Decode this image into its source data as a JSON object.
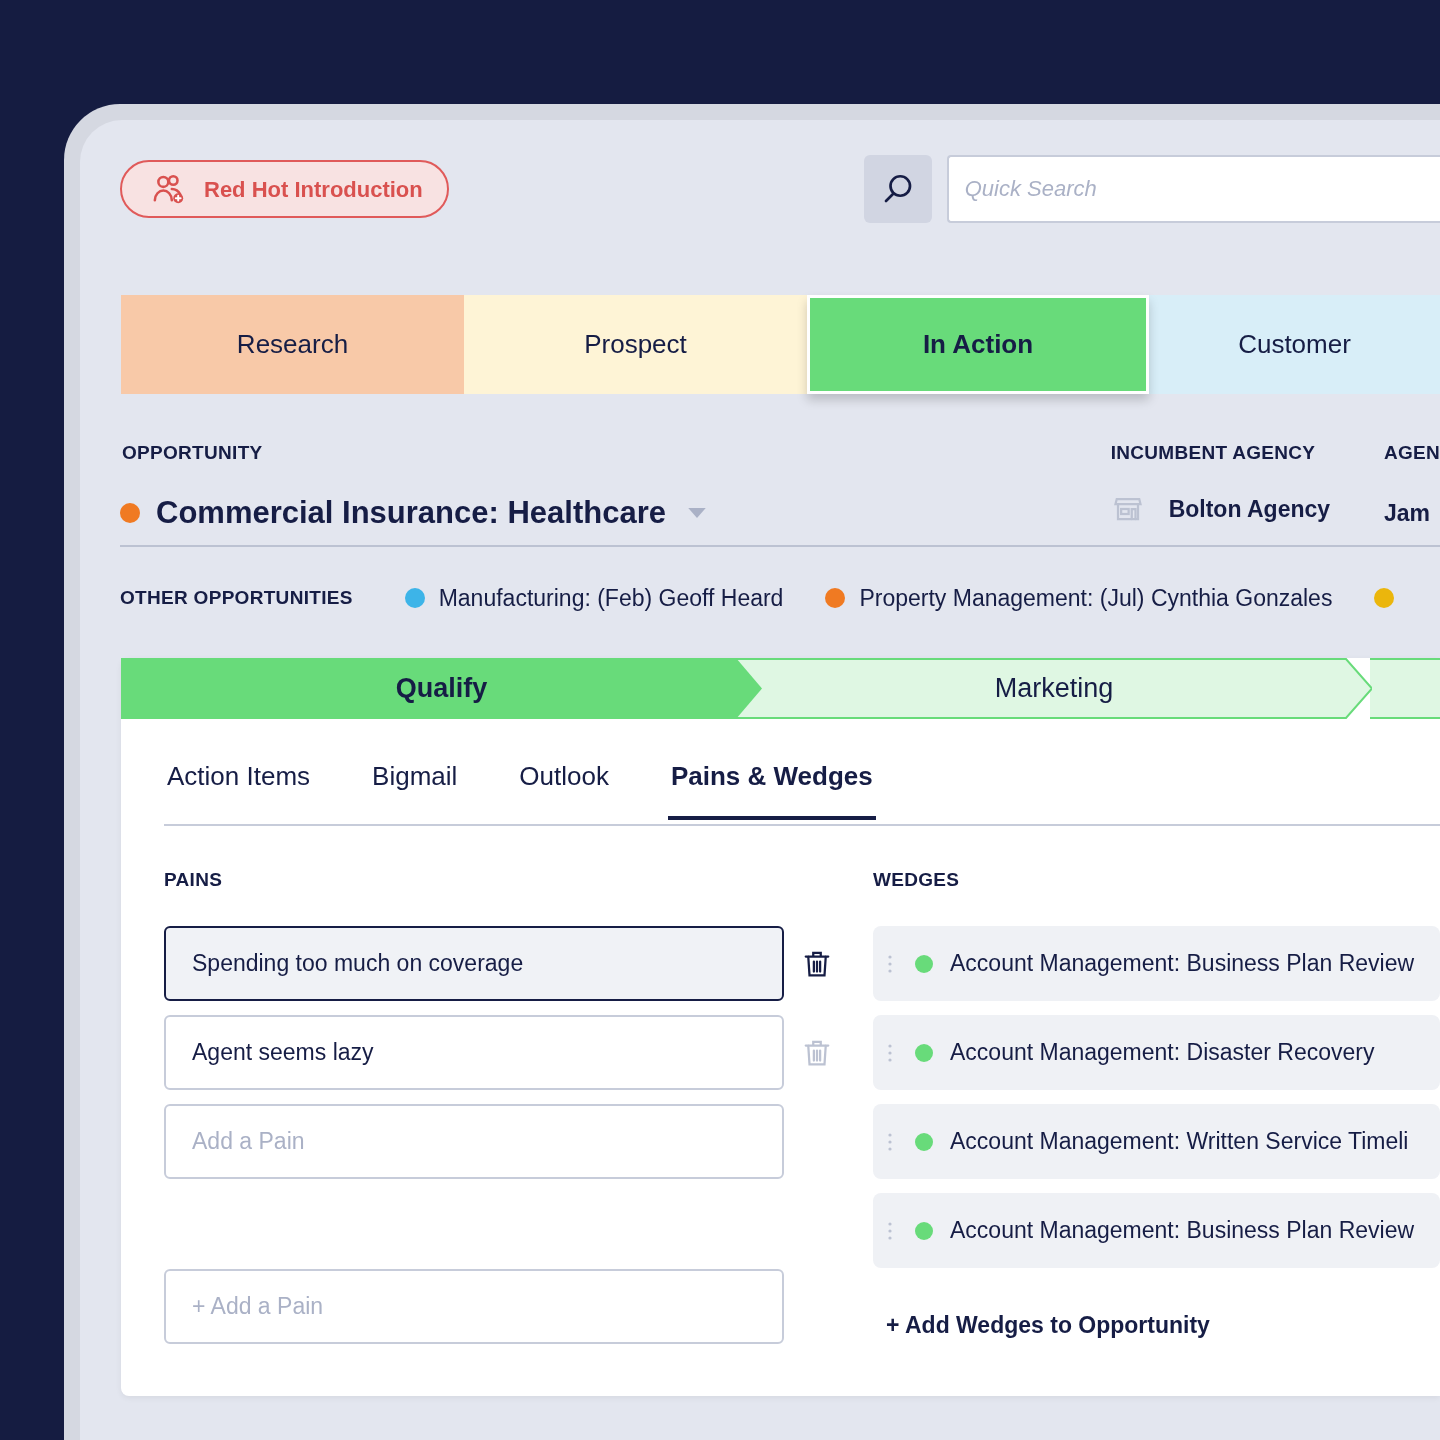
{
  "intro_button": {
    "label": "Red Hot Introduction"
  },
  "search": {
    "placeholder": "Quick Search"
  },
  "stages": [
    {
      "label": "Research",
      "selected": false,
      "color": "#f8c9a8"
    },
    {
      "label": "Prospect",
      "selected": false,
      "color": "#fef4d6"
    },
    {
      "label": "In Action",
      "selected": true,
      "color": "#68db7a"
    },
    {
      "label": "Customer",
      "selected": false,
      "color": "#d8eef8"
    }
  ],
  "opportunity": {
    "label": "OPPORTUNITY",
    "color": "#f07a22",
    "name": "Commercial Insurance: Healthcare"
  },
  "incumbent_agency": {
    "label": "INCUMBENT AGENCY",
    "value": "Bolton Agency"
  },
  "agent": {
    "label": "AGEN",
    "value": "Jam"
  },
  "other_opportunities": {
    "label": "OTHER OPPORTUNITIES",
    "items": [
      {
        "color": "#3db4e8",
        "text": "Manufacturing: (Feb) Geoff Heard"
      },
      {
        "color": "#f07a22",
        "text": "Property Management: (Jul) Cynthia Gonzales"
      },
      {
        "color": "#ebb60c"
      }
    ]
  },
  "steps": [
    {
      "label": "Qualify",
      "selected": true
    },
    {
      "label": "Marketing",
      "selected": false
    }
  ],
  "tabs": [
    {
      "label": "Action Items",
      "selected": false
    },
    {
      "label": "Bigmail",
      "selected": false
    },
    {
      "label": "Outlook",
      "selected": false
    },
    {
      "label": "Pains & Wedges",
      "selected": true
    }
  ],
  "pains": {
    "title": "PAINS",
    "items": [
      {
        "value": "Spending too much on coverage",
        "focused": true
      },
      {
        "value": "Agent seems lazy",
        "focused": false
      },
      {
        "placeholder": "Add a Pain"
      }
    ],
    "add": {
      "placeholder": "+ Add a Pain"
    }
  },
  "wedges": {
    "title": "WEDGES",
    "items": [
      {
        "text": "Account Management: Business Plan Review",
        "color": "#68db7a"
      },
      {
        "text": "Account Management: Disaster Recovery",
        "color": "#68db7a"
      },
      {
        "text": "Account Management: Written Service Timeli",
        "color": "#68db7a"
      },
      {
        "text": "Account Management: Business Plan Review",
        "color": "#68db7a"
      }
    ],
    "add_link": "+ Add Wedges to Opportunity"
  }
}
